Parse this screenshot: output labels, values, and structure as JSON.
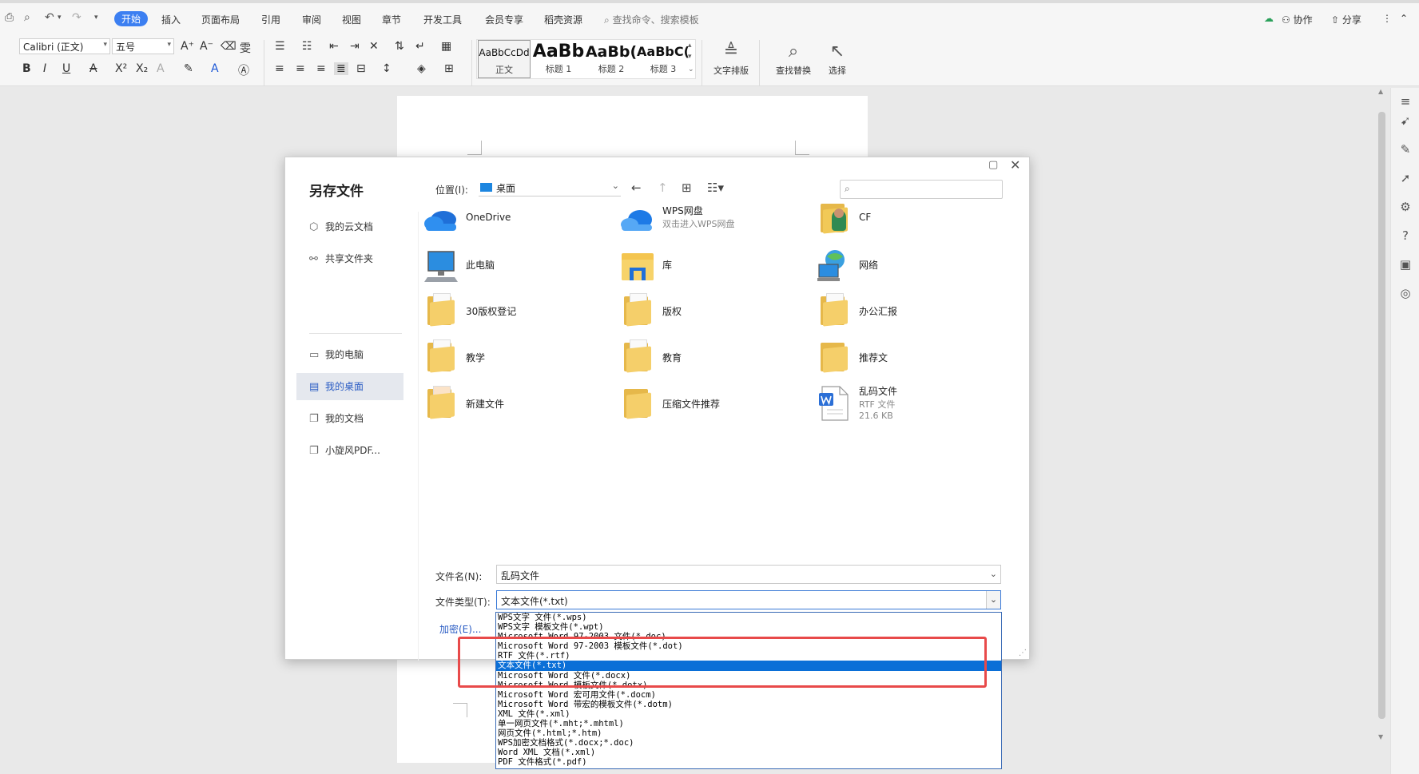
{
  "ribbon": {
    "tabs": [
      "开始",
      "插入",
      "页面布局",
      "引用",
      "审阅",
      "视图",
      "章节",
      "开发工具",
      "会员专享",
      "稻壳资源"
    ],
    "search_placeholder": "查找命令、搜索模板",
    "collab_label": "协作",
    "share_label": "分享",
    "font_name": "Calibri (正文)",
    "font_size": "五号",
    "styles": [
      {
        "sample": "AaBbCcDd",
        "name": "正文"
      },
      {
        "sample": "AaBb",
        "name": "标题 1"
      },
      {
        "sample": "AaBb(",
        "name": "标题 2"
      },
      {
        "sample": "AaBbC(",
        "name": "标题 3"
      }
    ],
    "text_layout_label": "文字排版",
    "find_replace_label": "查找替换",
    "select_label": "选择"
  },
  "dialog": {
    "title": "另存文件",
    "nav": [
      "我的云文档",
      "共享文件夹",
      "我的电脑",
      "我的桌面",
      "我的文档",
      "小旋风PDF..."
    ],
    "location_label": "位置(I):",
    "location_value": "桌面",
    "search_placeholder": "",
    "files": [
      {
        "name": "OneDrive",
        "sub": ""
      },
      {
        "name": "WPS网盘",
        "sub": "双击进入WPS网盘"
      },
      {
        "name": "CF",
        "sub": ""
      },
      {
        "name": "此电脑",
        "sub": ""
      },
      {
        "name": "库",
        "sub": ""
      },
      {
        "name": "网络",
        "sub": ""
      },
      {
        "name": "30版权登记",
        "sub": ""
      },
      {
        "name": "版权",
        "sub": ""
      },
      {
        "name": "办公汇报",
        "sub": ""
      },
      {
        "name": "教学",
        "sub": ""
      },
      {
        "name": "教育",
        "sub": ""
      },
      {
        "name": "推荐文",
        "sub": ""
      },
      {
        "name": "新建文件",
        "sub": ""
      },
      {
        "name": "压缩文件推荐",
        "sub": ""
      },
      {
        "name": "乱码文件",
        "sub": "RTF 文件",
        "sub2": "21.6 KB"
      }
    ],
    "filename_label": "文件名(N):",
    "filename_value": "乱码文件",
    "filetype_label": "文件类型(T):",
    "filetype_value": "文本文件(*.txt)",
    "encrypt_label": "加密(E)..."
  },
  "filetype_options": [
    "WPS文字 文件(*.wps)",
    "WPS文字 模板文件(*.wpt)",
    "Microsoft Word 97-2003 文件(*.doc)",
    "Microsoft Word 97-2003 模板文件(*.dot)",
    "RTF 文件(*.rtf)",
    "文本文件(*.txt)",
    "Microsoft Word 文件(*.docx)",
    "Microsoft Word 模板文件(*.dotx)",
    "Microsoft Word 宏可用文件(*.docm)",
    "Microsoft Word 带宏的模板文件(*.dotm)",
    "XML 文件(*.xml)",
    "单一网页文件(*.mht;*.mhtml)",
    "网页文件(*.html;*.htm)",
    "WPS加密文档格式(*.docx;*.doc)",
    "Word XML 文档(*.xml)",
    "PDF 文件格式(*.pdf)"
  ],
  "selected_option_index": 5,
  "colors": {
    "accent": "#3c7ff1",
    "selection": "#0a6fd7",
    "highlight_box": "#e84a4a",
    "folder": "#f5cf6a"
  }
}
